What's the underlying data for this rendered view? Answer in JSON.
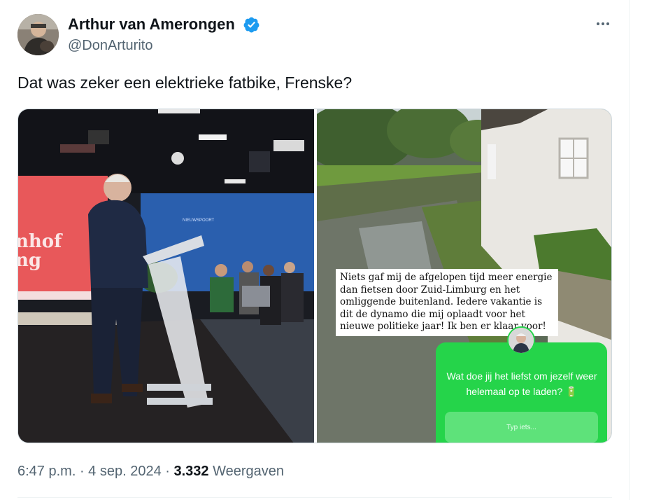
{
  "author": {
    "name": "Arthur van Amerongen",
    "handle": "@DonArturito",
    "verified": true
  },
  "tweet": {
    "text": "Dat was zeker een elektrieke fatbike, Frenske?"
  },
  "media": {
    "left_photo": {
      "poster_text_line1": "nhof",
      "poster_text_line2": "ng",
      "studio_sign": "NIEUWSPOORT"
    },
    "right_photo": {
      "caption": "Niets gaf mij de afgelopen tijd meer energie dan fietsen door Zuid-Limburg en het omliggende buitenland. Iedere vakantie is dit de dynamo die mij oplaadt voor het nieuwe politieke jaar! Ik ben er klaar voor!",
      "question": "Wat doe jij het liefst om jezelf weer helemaal op te laden? 🔋",
      "reply_placeholder": "Typ iets..."
    }
  },
  "meta": {
    "time": "6:47 p.m.",
    "sep1": " · ",
    "date": "4 sep. 2024",
    "sep2": " · ",
    "views_count": "3.332",
    "views_label": " Weergaven"
  },
  "colors": {
    "verified_blue": "#1d9bf0",
    "secondary_text": "#536471",
    "story_green": "#25d44a"
  },
  "icons": [
    "verified-badge-icon",
    "more-options-icon"
  ]
}
